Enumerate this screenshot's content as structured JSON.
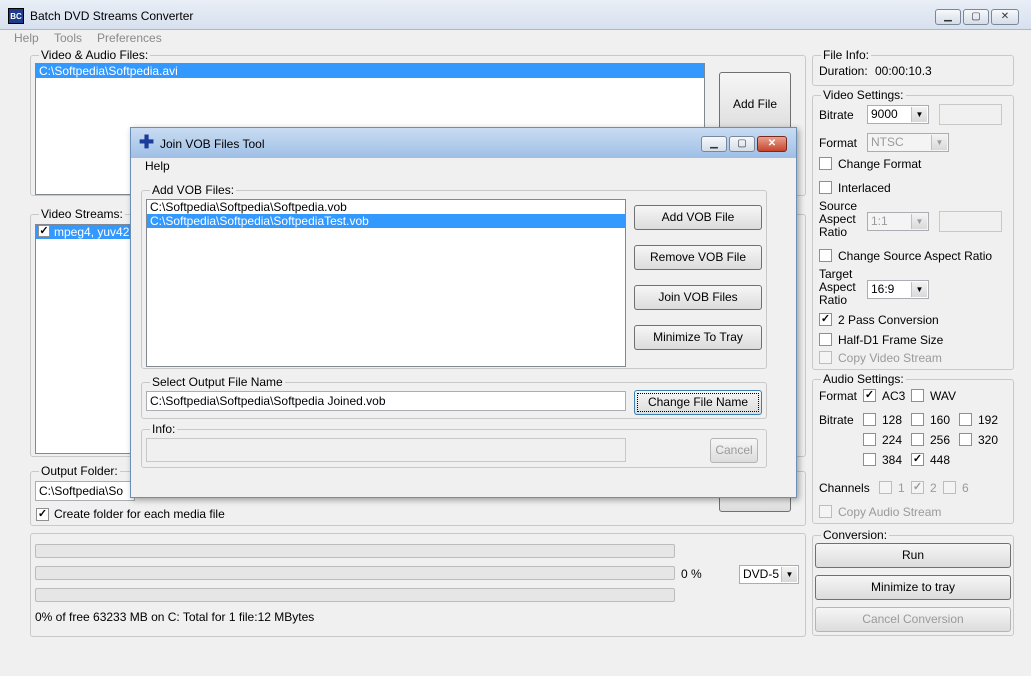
{
  "window": {
    "title": "Batch DVD Streams Converter",
    "icon_text": "BC"
  },
  "menu": [
    "Help",
    "Tools",
    "Preferences"
  ],
  "video_audio_files": {
    "legend": "Video & Audio Files:",
    "items": [
      "C:\\Softpedia\\Softpedia.avi"
    ],
    "add_file_label": "Add File"
  },
  "video_streams": {
    "legend": "Video Streams:",
    "items": [
      "mpeg4, yuv42"
    ]
  },
  "output_folder": {
    "legend": "Output Folder:",
    "path": "C:\\Softpedia\\So",
    "create_folder_label": "Create folder for each media file"
  },
  "progress": {
    "percent_text": "0 %",
    "disk_select": "DVD-5",
    "status": "0% of free 63233 MB on C: Total for 1 file:12 MBytes"
  },
  "file_info": {
    "legend": "File Info:",
    "duration_label": "Duration:",
    "duration_value": "00:00:10.3"
  },
  "video_settings": {
    "legend": "Video Settings:",
    "bitrate_label": "Bitrate",
    "bitrate_value": "9000",
    "format_label": "Format",
    "format_value": "NTSC",
    "change_format_label": "Change Format",
    "interlaced_label": "Interlaced",
    "source_aspect_label_1": "Source",
    "source_aspect_label_2": "Aspect",
    "source_aspect_label_3": "Ratio",
    "source_aspect_value": "1:1",
    "change_source_aspect_label": "Change Source Aspect Ratio",
    "target_aspect_label_1": "Target",
    "target_aspect_label_2": "Aspect",
    "target_aspect_label_3": "Ratio",
    "target_aspect_value": "16:9",
    "two_pass_label": "2 Pass Conversion",
    "half_d1_label": "Half-D1 Frame Size",
    "copy_video_label": "Copy Video Stream"
  },
  "audio_settings": {
    "legend": "Audio Settings:",
    "format_label": "Format",
    "ac3_label": "AC3",
    "wav_label": "WAV",
    "bitrate_label": "Bitrate",
    "b128": "128",
    "b160": "160",
    "b192": "192",
    "b224": "224",
    "b256": "256",
    "b320": "320",
    "b384": "384",
    "b448": "448",
    "channels_label": "Channels",
    "c1": "1",
    "c2": "2",
    "c6": "6",
    "copy_audio_label": "Copy Audio Stream"
  },
  "conversion": {
    "legend": "Conversion:",
    "run_label": "Run",
    "minimize_label": "Minimize to tray",
    "cancel_label": "Cancel Conversion"
  },
  "dialog": {
    "title": "Join VOB Files Tool",
    "menu_help": "Help",
    "add_vob_legend": "Add VOB Files:",
    "files": [
      "C:\\Softpedia\\Softpedia\\Softpedia.vob",
      "C:\\Softpedia\\Softpedia\\SoftpediaTest.vob"
    ],
    "add_vob_label": "Add VOB File",
    "remove_vob_label": "Remove VOB File",
    "join_label": "Join VOB Files",
    "minimize_label": "Minimize To Tray",
    "output_legend": "Select Output File Name",
    "output_path": "C:\\Softpedia\\Softpedia\\Softpedia Joined.vob",
    "change_name_label": "Change File Name",
    "info_legend": "Info:",
    "cancel_label": "Cancel"
  }
}
